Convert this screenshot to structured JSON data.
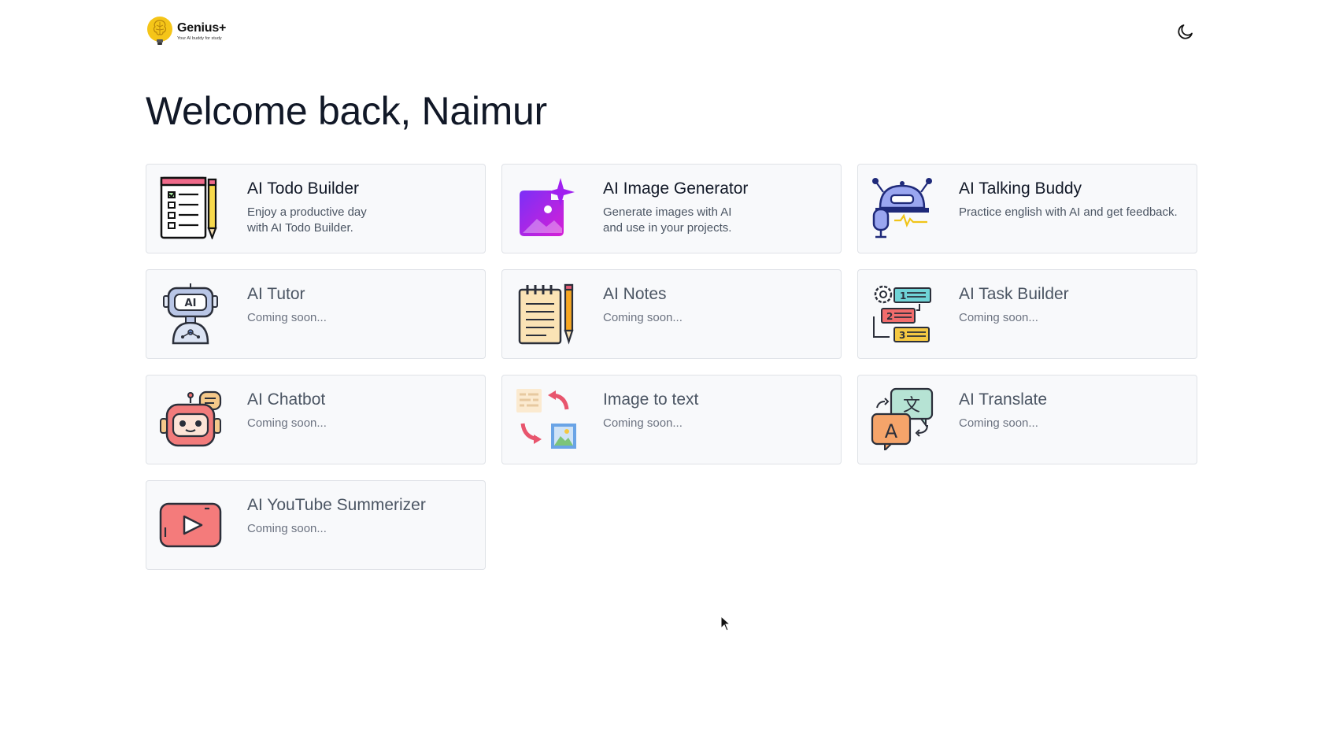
{
  "brand": {
    "name": "Genius+",
    "tagline": "Your AI buddy for study"
  },
  "header": {
    "theme_toggle_icon": "moon-icon"
  },
  "welcome": "Welcome back, Naimur",
  "cards": [
    {
      "title": "AI Todo Builder",
      "desc": "Enjoy a productive day\nwith AI Todo Builder.",
      "icon": "todo-list-icon"
    },
    {
      "title": "AI Image Generator",
      "desc": "Generate images with AI\nand use in your projects.",
      "icon": "image-sparkle-icon"
    },
    {
      "title": "AI Talking Buddy",
      "desc": "Practice english with AI and get feedback.",
      "icon": "robot-microphone-icon"
    },
    {
      "title": "AI Tutor",
      "desc": "Coming soon...",
      "icon": "ai-tutor-icon"
    },
    {
      "title": "AI Notes",
      "desc": "Coming soon...",
      "icon": "notepad-icon"
    },
    {
      "title": "AI Task Builder",
      "desc": "Coming soon...",
      "icon": "task-steps-icon"
    },
    {
      "title": "AI Chatbot",
      "desc": "Coming soon...",
      "icon": "chatbot-icon"
    },
    {
      "title": "Image to text",
      "desc": "Coming soon...",
      "icon": "image-to-text-icon"
    },
    {
      "title": "AI Translate",
      "desc": "Coming soon...",
      "icon": "translate-icon"
    },
    {
      "title": "AI YouTube Summerizer",
      "desc": "Coming soon...",
      "icon": "youtube-icon"
    }
  ],
  "colors": {
    "logo_yellow": "#f5c518",
    "image_gen_purple": "#a020f0",
    "youtube_red": "#f47b7b",
    "card_bg": "#f8f9fb",
    "card_border": "#dfe2e7"
  }
}
